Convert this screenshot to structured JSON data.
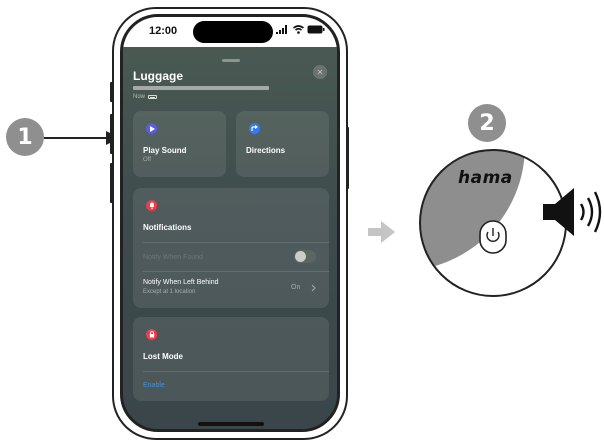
{
  "steps": {
    "first": "1",
    "second": "2"
  },
  "phone": {
    "status_time": "12:00",
    "status_icons": [
      "signal-icon",
      "wifi-icon",
      "battery-icon"
    ]
  },
  "sheet": {
    "title": "Luggage",
    "timestamp": "Now",
    "close_icon": "×"
  },
  "actions": {
    "play_sound": {
      "label": "Play Sound",
      "sub": "Off",
      "icon": "play-icon",
      "color": "#5b5ce6"
    },
    "directions": {
      "label": "Directions",
      "icon": "directions-arrow-icon",
      "color": "#2f7cf6"
    }
  },
  "notifications": {
    "heading": "Notifications",
    "icon": "bell-icon",
    "color": "#ef3b4a",
    "notify_found": {
      "label": "Notify When Found"
    },
    "notify_left_behind": {
      "label": "Notify When Left Behind",
      "sub": "Except at 1 location",
      "value": "On"
    }
  },
  "lost_mode": {
    "heading": "Lost Mode",
    "icon": "lock-icon",
    "color": "#ef3b4a",
    "enable_label": "Enable"
  },
  "device": {
    "brand": "hama"
  },
  "colors": {
    "step_badge": "#8f8f8f",
    "device_body": "#8e8e8e",
    "accent_link": "#4a8ed6"
  }
}
